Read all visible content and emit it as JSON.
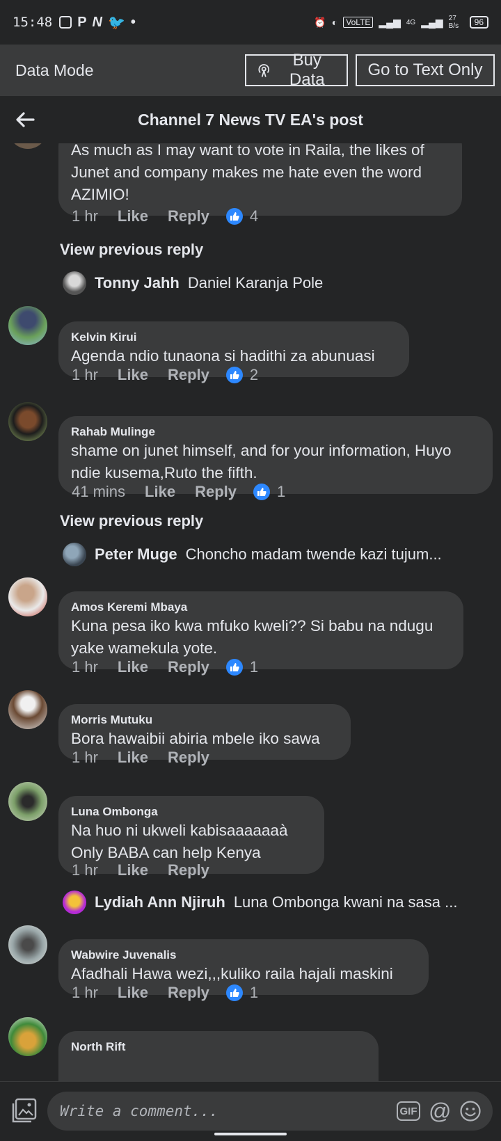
{
  "status_bar": {
    "time": "15:48",
    "volte": "VoLTE",
    "network": "4G",
    "speed": "27 B/s",
    "battery": "96"
  },
  "data_mode": {
    "title": "Data Mode",
    "buy_label": "Buy Data",
    "text_only_label": "Go to Text Only"
  },
  "header": {
    "title": "Channel 7 News TV EA's post"
  },
  "comments": [
    {
      "author": "",
      "text": "As much as I may want to vote in Raila, the likes of Junet and company makes me hate even the word AZIMIO!",
      "time": "1 hr",
      "like": "Like",
      "reply": "Reply",
      "reactions": "4"
    },
    {
      "author": "Kelvin Kirui",
      "text": "Agenda ndio tunaona si hadithi za abunuasi",
      "time": "1 hr",
      "like": "Like",
      "reply": "Reply",
      "reactions": "2"
    },
    {
      "author": "Rahab Mulinge",
      "text": "shame on junet himself, and for your information, Huyo ndie kusema,Ruto the fifth.",
      "time": "41 mins",
      "like": "Like",
      "reply": "Reply",
      "reactions": "1"
    },
    {
      "author": "Amos Keremi Mbaya",
      "text": "Kuna pesa iko kwa mfuko kweli?? Si babu na ndugu yake wamekula yote.",
      "time": "1 hr",
      "like": "Like",
      "reply": "Reply",
      "reactions": "1"
    },
    {
      "author": "Morris Mutuku",
      "text": "Bora hawaibii abiria mbele iko sawa",
      "time": "1 hr",
      "like": "Like",
      "reply": "Reply"
    },
    {
      "author": "Luna Ombonga",
      "text": "Na huo ni ukweli kabisaaaaaaà Only BABA can help Kenya",
      "time": "1 hr",
      "like": "Like",
      "reply": "Reply"
    },
    {
      "author": "Wabwire Juvenalis",
      "text": "Afadhali Hawa wezi,,,kuliko raila hajali maskini",
      "time": "1 hr",
      "like": "Like",
      "reply": "Reply",
      "reactions": "1"
    },
    {
      "author": "North Rift"
    }
  ],
  "view_previous": "View previous reply",
  "replies": [
    {
      "name": "Tonny Jahh",
      "text": "Daniel Karanja Pole"
    },
    {
      "name": "Peter Muge",
      "text": "Choncho madam twende kazi tujum..."
    },
    {
      "name": "Lydiah Ann Njiruh",
      "text": "Luna Ombonga kwani na sasa ..."
    }
  ],
  "composer": {
    "placeholder": "Write a comment...",
    "gif": "GIF",
    "at": "@"
  }
}
